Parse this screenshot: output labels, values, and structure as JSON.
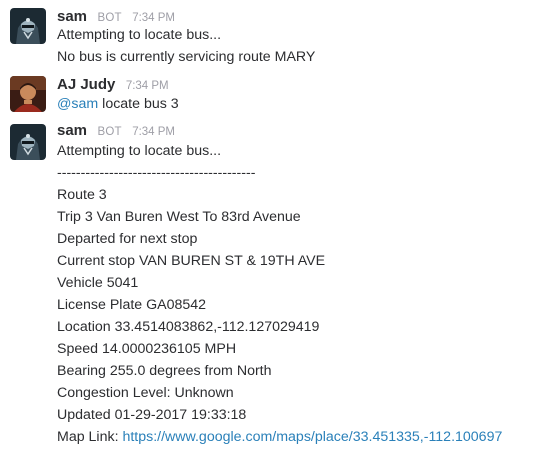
{
  "messages": [
    {
      "author": "sam",
      "bot_tag": "BOT",
      "time": "7:34 PM",
      "avatar": "robot-helmet-avatar",
      "lines": [
        "Attempting to locate bus...",
        "No bus is currently servicing route MARY"
      ]
    },
    {
      "author": "AJ Judy",
      "time": "7:34 PM",
      "avatar": "user-photo-avatar",
      "mention": "@sam",
      "text": " locate bus 3"
    },
    {
      "author": "sam",
      "bot_tag": "BOT",
      "time": "7:34 PM",
      "avatar": "robot-helmet-avatar",
      "lines": [
        "Attempting to locate bus...",
        "------------------------------------------",
        "Route 3",
        "Trip 3 Van Buren West To 83rd Avenue",
        "Departed for next stop",
        "Current stop VAN BUREN ST & 19TH AVE",
        "Vehicle 5041",
        "License Plate GA08542",
        "Location 33.4514083862,-112.127029419",
        "Speed 14.0000236105 MPH",
        "Bearing 255.0 degrees from North",
        "Congestion Level: Unknown",
        "Updated 01-29-2017 19:33:18"
      ],
      "map_label": "Map Link: ",
      "map_link": "https://www.google.com/maps/place/33.451335,-112.100697"
    }
  ]
}
